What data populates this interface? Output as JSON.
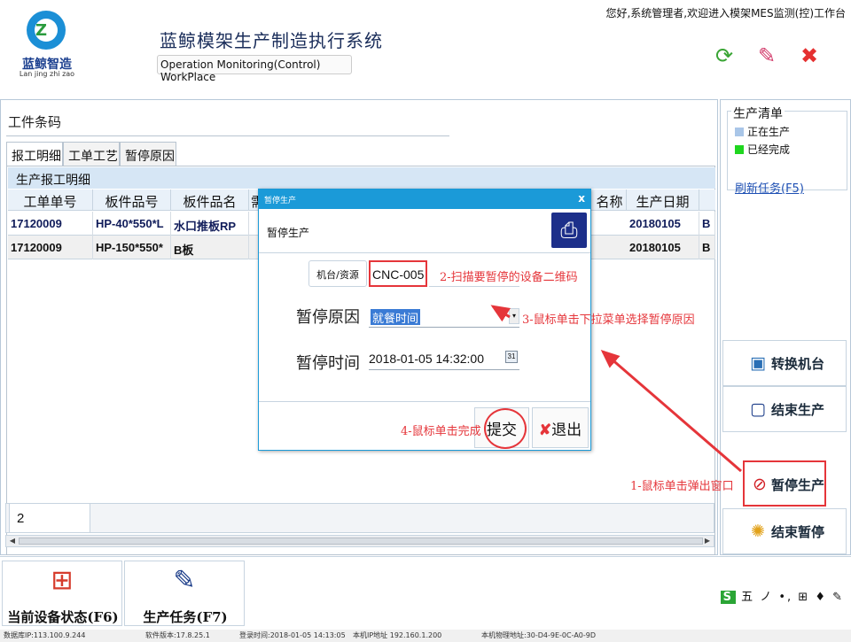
{
  "header": {
    "logo_text": "蓝鲸智造",
    "logo_sub": "Lan jing zhi zao",
    "title": "蓝鲸模架生产制造执行系统",
    "subtitle": "Operation Monitoring(Control) WorkPlace",
    "greeting": "您好,系统管理者,欢迎进入模架MES监测(控)工作台",
    "icons": [
      "refresh-icon",
      "pin-icon",
      "close-icon"
    ]
  },
  "main": {
    "barcode_label": "工件条码",
    "tabs": [
      "报工明细",
      "工单工艺",
      "暂停原因"
    ],
    "grid_title": "生产报工明细",
    "columns": [
      "工单单号",
      "板件品号",
      "板件品名",
      "需",
      "名称",
      "生产日期"
    ],
    "rows": [
      [
        "17120009",
        "HP-40*550*L",
        "水口推板RP",
        "",
        "20180105",
        "B"
      ],
      [
        "17120009",
        "HP-150*550*",
        "B板",
        "",
        "20180105",
        "B"
      ]
    ],
    "count": "2"
  },
  "right": {
    "list_title": "生产清单",
    "legend": [
      {
        "label": "正在生产",
        "color": "#a9c6e8"
      },
      {
        "label": "已经完成",
        "color": "#1fd61f"
      }
    ],
    "refresh_link": "刷新任务(F5)",
    "buttons": [
      {
        "label": "转换机台",
        "icon": "switch-machine-icon"
      },
      {
        "label": "结束生产",
        "icon": "end-production-icon"
      },
      {
        "label": "暂停生产",
        "icon": "pause-production-icon"
      },
      {
        "label": "结束暂停",
        "icon": "end-pause-icon"
      }
    ]
  },
  "footer": {
    "buttons": [
      {
        "label": "当前设备状态(F6)",
        "icon": "device-status-icon"
      },
      {
        "label": "生产任务(F7)",
        "icon": "production-task-icon"
      }
    ],
    "ime": "五 ノ •, ⊞ ♦ ✎",
    "status": [
      "数据库IP:113.100.9.244",
      "软件版本:17.8.25.1",
      "登录时间:2018-01-05 14:13:05",
      "本机IP地址 192.160.1.200",
      "本机物理地址:30-D4-9E-0C-A0-9D"
    ]
  },
  "dialog": {
    "window_title": "暂停生产",
    "heading": "暂停生产",
    "machine_button": "机台/资源",
    "machine_value": "CNC-005",
    "reason_label": "暂停原因",
    "reason_value": "就餐时间",
    "time_label": "暂停时间",
    "time_value": "2018-01-05 14:32:00",
    "submit": "提交",
    "exit": "退出"
  },
  "annotations": {
    "step1": "1-鼠标单击弹出窗口",
    "step2": "2-扫描要暂停的设备二维码",
    "step3": "3-鼠标单击下拉菜单选择暂停原因",
    "step4": "4-鼠标单击完成"
  },
  "colors": {
    "accent": "#1b9ad8",
    "highlight": "#e5353a",
    "grid_header": "#d6e6f5"
  }
}
